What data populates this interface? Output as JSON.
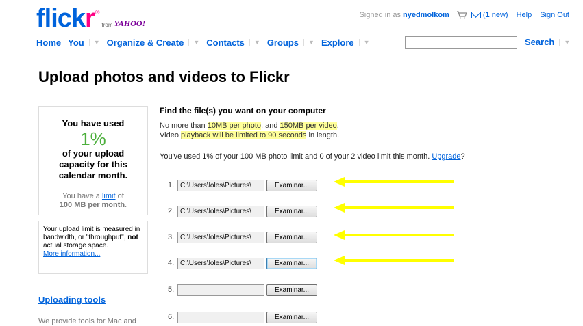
{
  "header": {
    "logo_text": "flickr",
    "logo_from": "from",
    "logo_yahoo": "YAHOO!",
    "signed_in_prefix": "Signed in as",
    "username": "nyedmolkom",
    "new_messages_count": "1",
    "new_messages_suffix": "new",
    "help": "Help",
    "sign_out": "Sign Out"
  },
  "nav": {
    "items": [
      {
        "label": "Home"
      },
      {
        "label": "You"
      },
      {
        "label": "Organize & Create"
      },
      {
        "label": "Contacts"
      },
      {
        "label": "Groups"
      },
      {
        "label": "Explore"
      }
    ],
    "search_label": "Search",
    "search_value": ""
  },
  "page": {
    "title": "Upload photos and videos to Flickr"
  },
  "usage_box": {
    "line1": "You have used",
    "percent": "1%",
    "line2": "of your upload",
    "line3": "capacity for this",
    "line4": "calendar month.",
    "limit_prefix": "You have a",
    "limit_link": "limit",
    "limit_suffix": "of",
    "limit_amount": "100 MB per month",
    "limit_end": "."
  },
  "info_box": {
    "text1": "Your upload limit is measured in bandwidth, or \"throughput\",",
    "not": "not",
    "text2": "actual storage space.",
    "more_link": "More information..."
  },
  "sidebar": {
    "tools_title": "Uploading tools",
    "tools_text": "We provide tools for Mac and"
  },
  "main": {
    "heading": "Find the file(s) you want on your computer",
    "limit_a": "No more than",
    "limit_photo": "10MB per photo",
    "limit_b": ", and",
    "limit_video": "150MB per video",
    "limit_c": ".",
    "video_a": "Video",
    "video_hl": "playback will be limited to 90 seconds",
    "video_b": "in length.",
    "usage_text": "You've used 1% of your 100 MB photo limit and 0 of your 2 video limit this month.",
    "upgrade": "Upgrade",
    "usage_end": "?"
  },
  "files": [
    {
      "num": "1.",
      "value": "C:\\Users\\loles\\Pictures\\",
      "button": "Examinar..."
    },
    {
      "num": "2.",
      "value": "C:\\Users\\loles\\Pictures\\",
      "button": "Examinar..."
    },
    {
      "num": "3.",
      "value": "C:\\Users\\loles\\Pictures\\",
      "button": "Examinar..."
    },
    {
      "num": "4.",
      "value": "C:\\Users\\loles\\Pictures\\",
      "button": "Examinar..."
    },
    {
      "num": "5.",
      "value": "",
      "button": "Examinar..."
    },
    {
      "num": "6.",
      "value": "",
      "button": "Examinar..."
    }
  ],
  "colors": {
    "brand_blue": "#0063dc",
    "brand_pink": "#ff0084",
    "highlight": "#ffff99",
    "arrow_yellow": "#ffff00",
    "usage_green": "#4caf3c"
  }
}
